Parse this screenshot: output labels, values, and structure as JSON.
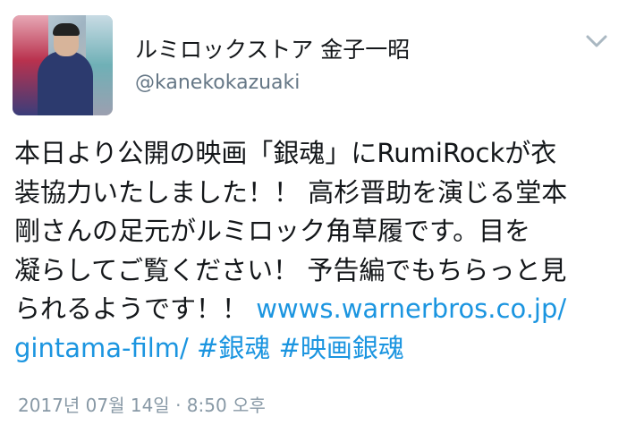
{
  "user": {
    "display_name": "ルミロックストア 金子一昭",
    "handle": "@kanekokazuaki"
  },
  "menu": {
    "icon": "chevron-down-icon"
  },
  "tweet": {
    "line1": "本日より公開の映画「銀魂」にRumiRockが衣",
    "line2": "装協力いたしました！！ 高杉晋助を演じる堂本",
    "line3": "剛さんの足元がルミロック角草履です。目を",
    "line4": "凝らしてご覧ください！ 予告編でもちらっと見",
    "line5_text": "られるようです！！ ",
    "link_part1": "wwws.warnerbros.co.jp/",
    "link_part2": "gintama-film/",
    "hashtag1": "#銀魂",
    "hashtag2": "#映画銀魂",
    "link_color": "#1b95e0"
  },
  "timestamp": "2017년 07월 14일 · 8:50 오후"
}
